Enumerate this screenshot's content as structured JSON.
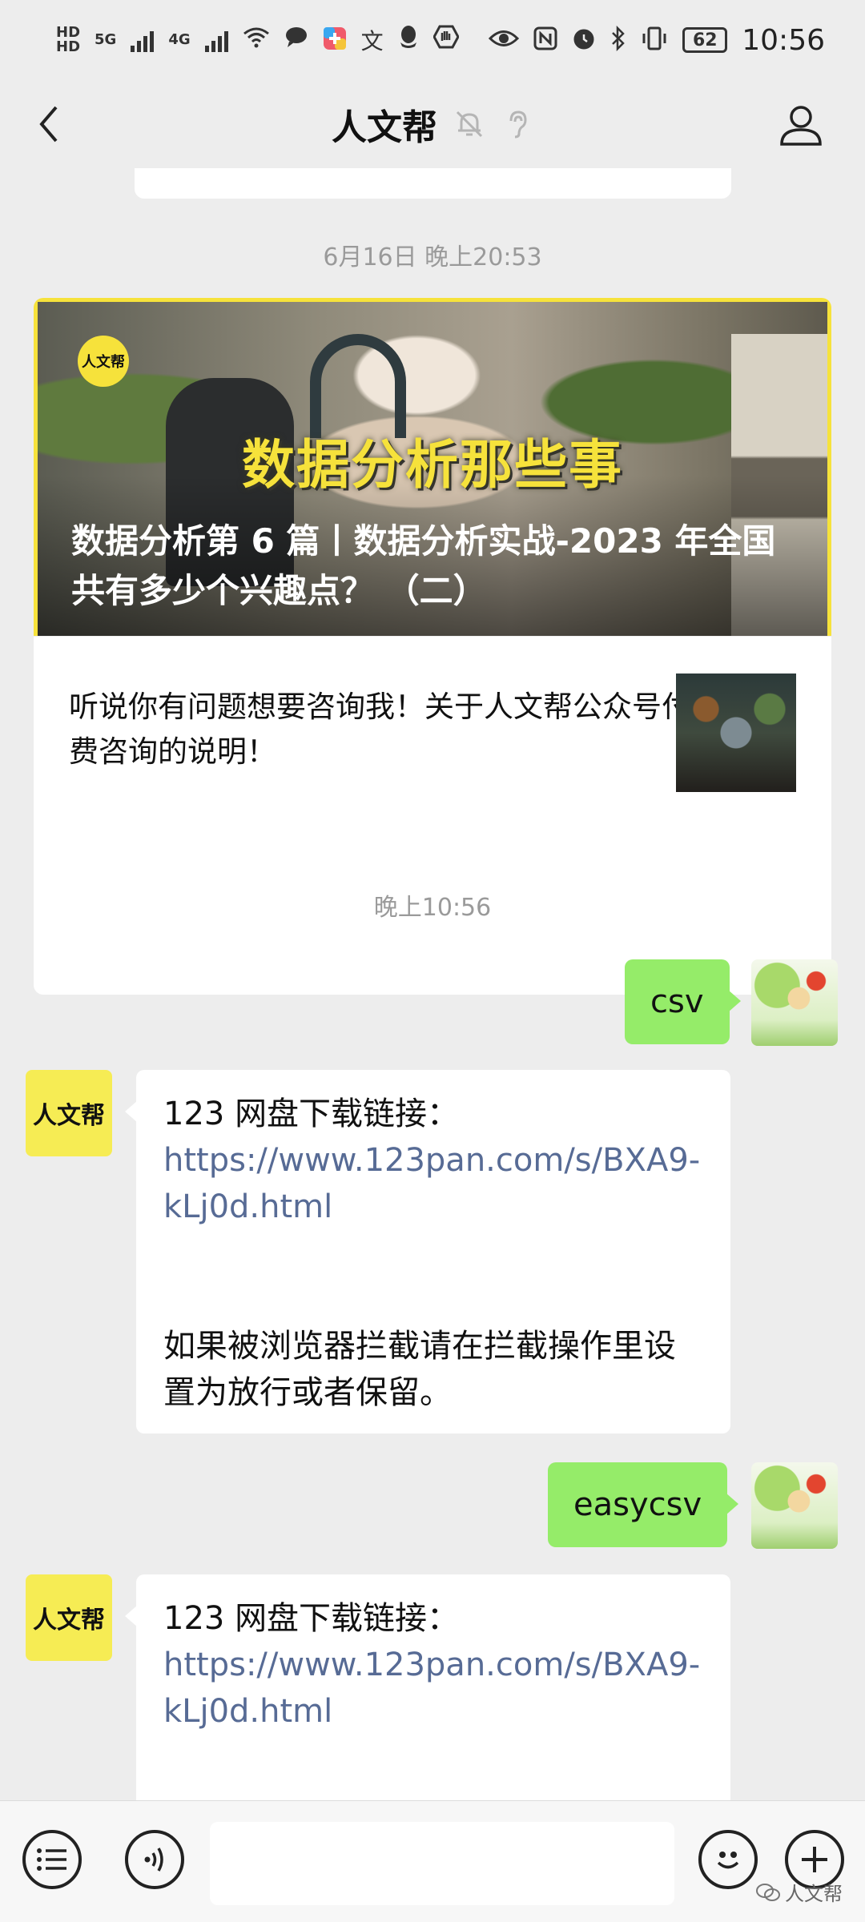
{
  "status_bar": {
    "net_hd1": "HD",
    "net_hd2": "HD",
    "net_5g": "5G",
    "net_4g": "4G",
    "battery": "62",
    "time": "10:56"
  },
  "nav": {
    "title": "人文帮"
  },
  "timestamps": {
    "first": "6月16日 晚上20:53",
    "second": "晚上10:56"
  },
  "article": {
    "cover_logo": "人文帮",
    "cover_headline": "数据分析那些事",
    "title": "数据分析第 6 篇丨数据分析实战-2023 年全国共有多少个兴趣点？ （二）",
    "sub_title": "听说你有问题想要咨询我！关于人文帮公众号付费咨询的说明！"
  },
  "messages": {
    "m1_text": "csv",
    "m2_brand": "人文帮",
    "m2_line1": "123 网盘下载链接：",
    "m2_link": "https://www.123pan.com/s/BXA9-kLj0d.html",
    "m2_line2": "如果被浏览器拦截请在拦截操作里设置为放行或者保留。",
    "m3_text": "easycsv",
    "m4_brand": "人文帮",
    "m4_line1": "123 网盘下载链接：",
    "m4_link": "https://www.123pan.com/s/BXA9-kLj0d.html"
  },
  "footer": {
    "watermark": "人文帮"
  },
  "colors": {
    "background": "#ededed",
    "sent_bubble": "#95ec69",
    "link": "#576b95",
    "brand_yellow": "#f6ec54"
  }
}
